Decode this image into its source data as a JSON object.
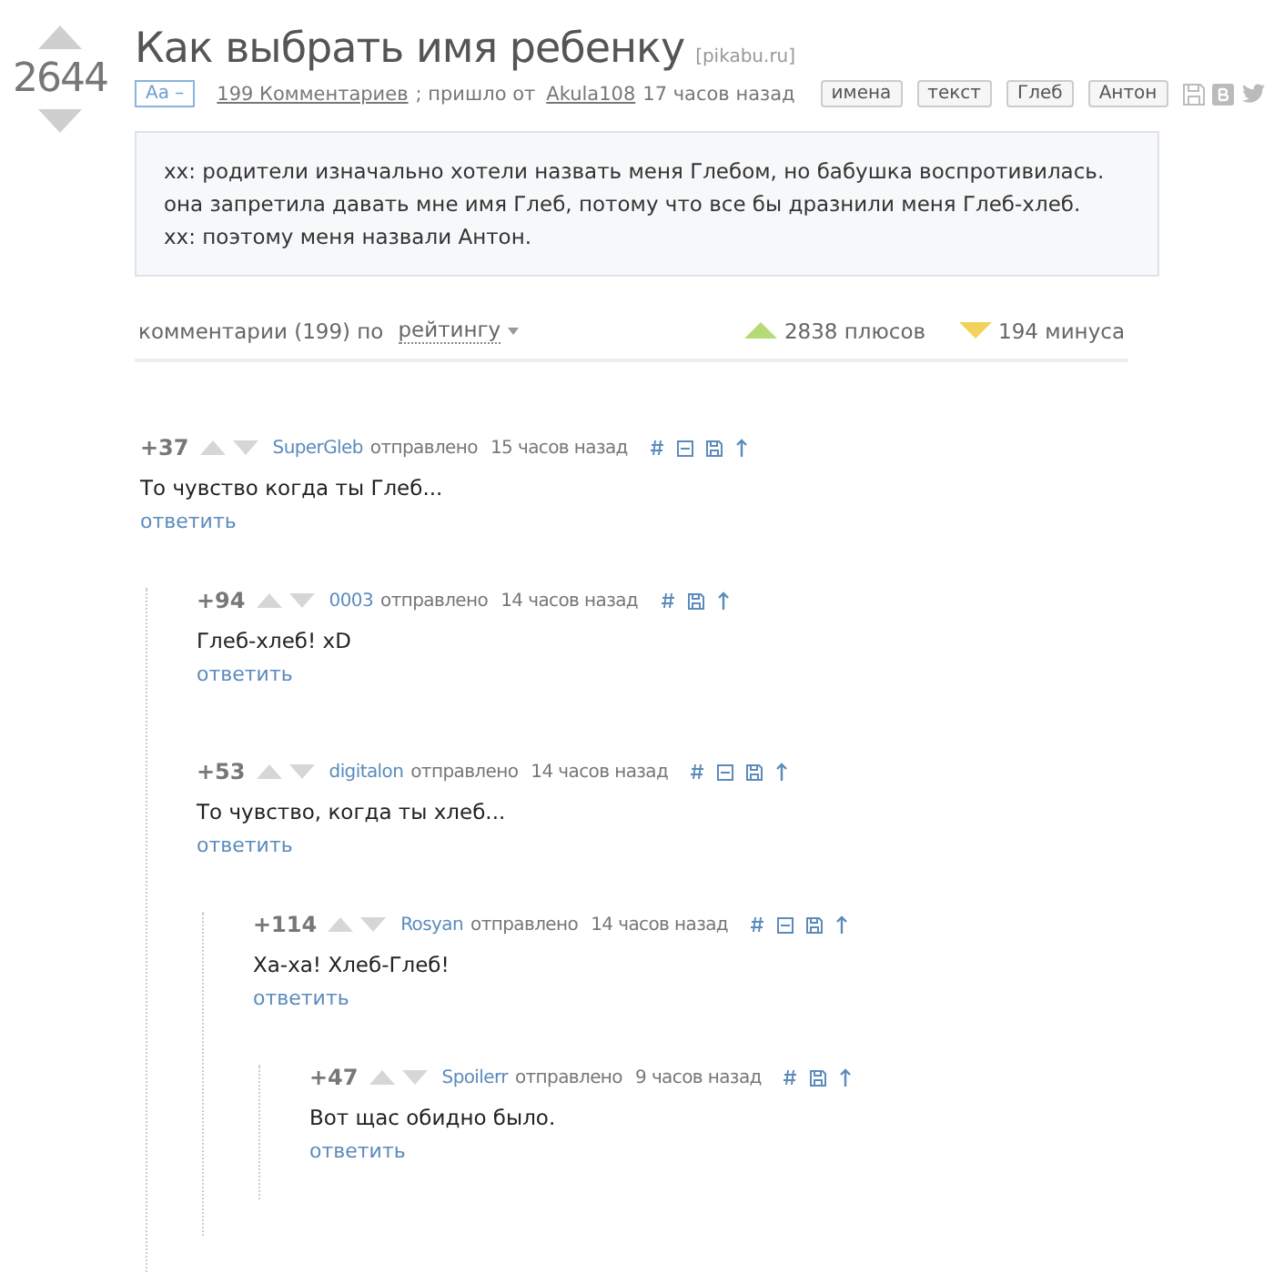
{
  "post": {
    "rating": "2644",
    "title": "Как выбрать имя ребенку",
    "source": "[pikabu.ru]",
    "font_toggle": "Aa –",
    "comments_link": "199 Комментариев",
    "came_from": "; пришло от",
    "author": "Akula108",
    "time": "17 часов назад",
    "tags": [
      "имена",
      "текст",
      "Глеб",
      "Антон"
    ],
    "text": [
      "xx: родители изначально хотели назвать меня Глебом, но бабушка воспротивилась. она запретила давать мне имя Глеб, потому что все бы дразнили меня Глеб-хлеб.",
      "xx: поэтому меня назвали Антон."
    ]
  },
  "comments_bar": {
    "label": "комментарии (199) по",
    "sort": "рейтингу",
    "plus": "2838 плюсов",
    "minus": "194 минуса"
  },
  "comments": [
    {
      "score": "+37",
      "user": "SuperGleb",
      "sent": "отправлено",
      "time": "15 часов назад",
      "collapsible": true,
      "text": "То чувство когда ты Глеб...",
      "reply": "ответить",
      "children": [
        {
          "score": "+94",
          "user": "0003",
          "sent": "отправлено",
          "time": "14 часов назад",
          "collapsible": false,
          "text": "Глеб-хлеб! xD",
          "reply": "ответить"
        },
        {
          "score": "+53",
          "user": "digitalon",
          "sent": "отправлено",
          "time": "14 часов назад",
          "collapsible": true,
          "text": "То чувство, когда ты хлеб...",
          "reply": "ответить",
          "children": [
            {
              "score": "+114",
              "user": "Rosyan",
              "sent": "отправлено",
              "time": "14 часов назад",
              "collapsible": true,
              "text": "Ха-ха! Хлеб-Глеб!",
              "reply": "ответить",
              "children": [
                {
                  "score": "+47",
                  "user": "Spoilerr",
                  "sent": "отправлено",
                  "time": "9 часов назад",
                  "collapsible": false,
                  "text": "Вот щас обидно было.",
                  "reply": "ответить"
                }
              ]
            }
          ]
        }
      ]
    }
  ]
}
